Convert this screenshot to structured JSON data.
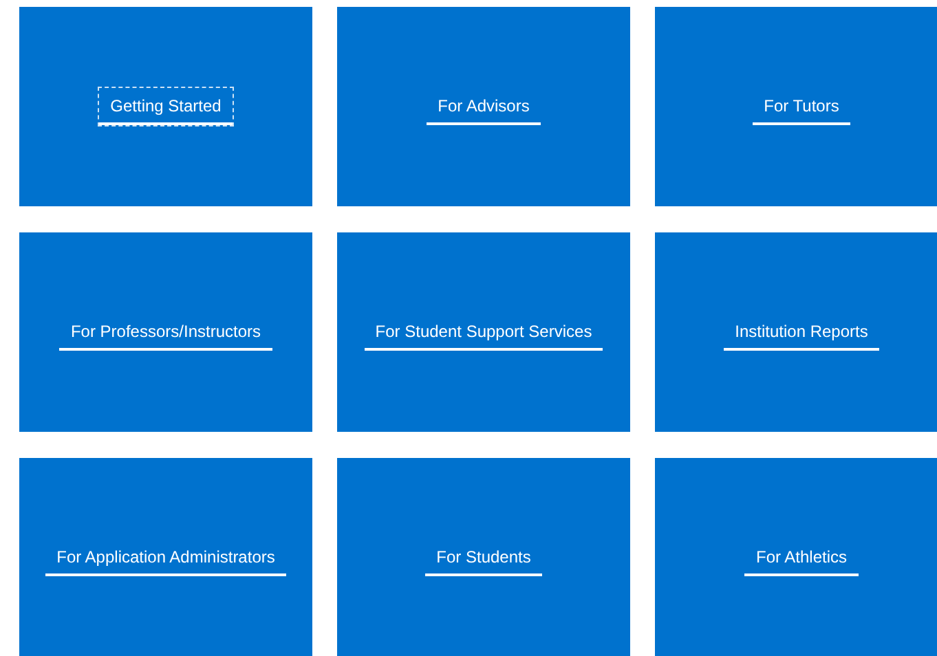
{
  "tiles": [
    {
      "label": "Getting Started",
      "focused": true
    },
    {
      "label": "For Advisors",
      "focused": false
    },
    {
      "label": "For Tutors",
      "focused": false
    },
    {
      "label": "For Professors/Instructors",
      "focused": false
    },
    {
      "label": "For Student Support Services",
      "focused": false
    },
    {
      "label": "Institution Reports",
      "focused": false
    },
    {
      "label": "For Application Administrators",
      "focused": false
    },
    {
      "label": "For Students",
      "focused": false
    },
    {
      "label": "For Athletics",
      "focused": false
    }
  ]
}
